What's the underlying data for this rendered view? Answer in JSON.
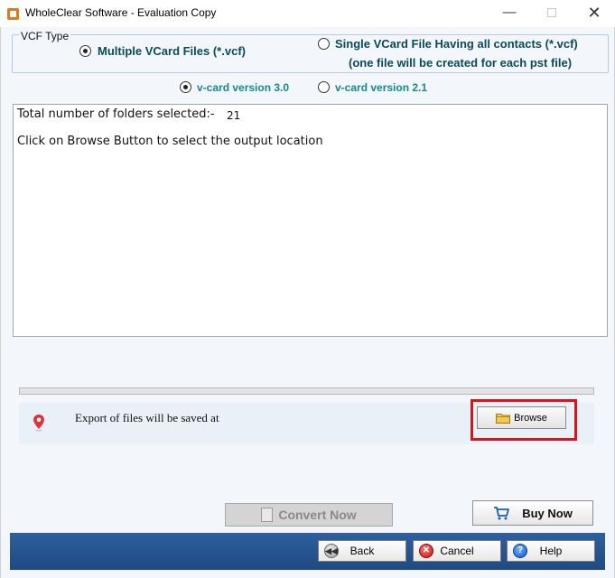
{
  "window": {
    "title": "WholeClear Software - Evaluation Copy",
    "minimize": "—",
    "close": "✕"
  },
  "vcf_type": {
    "legend": "VCF Type",
    "options": [
      {
        "label": "Multiple VCard Files (*.vcf)",
        "selected": true
      },
      {
        "label": "Single VCard File Having all contacts (*.vcf)",
        "sublabel": "(one file will be created for each pst file)",
        "selected": false
      }
    ]
  },
  "vcard_version": {
    "options": [
      {
        "label": "v-card version 3.0",
        "selected": true
      },
      {
        "label": "v-card version 2.1",
        "selected": false
      }
    ]
  },
  "log": {
    "folders_label": "Total number of folders selected:-",
    "folders_count": "21",
    "instruction": "Click on Browse Button to select the output location"
  },
  "save": {
    "label": "Export of files will be saved at",
    "browse_label": "Browse"
  },
  "actions": {
    "convert_label": "Convert Now",
    "buy_label": "Buy Now"
  },
  "nav": {
    "back_label": "Back",
    "cancel_label": "Cancel",
    "help_label": "Help"
  },
  "colors": {
    "highlight": "#d9141c",
    "bottom_bar": "#2e5f9e",
    "accent_label": "#0b4a57",
    "version_label": "#138a8a"
  },
  "icons": [
    "app-icon",
    "radio-icon",
    "location-pin-icon",
    "folder-icon",
    "document-icon",
    "cart-icon",
    "back-arrow-icon",
    "cancel-icon",
    "help-icon"
  ]
}
